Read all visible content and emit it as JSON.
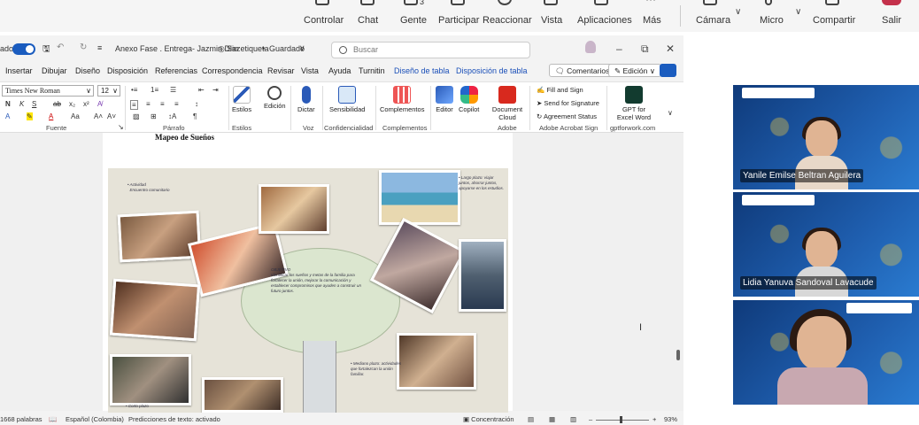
{
  "teams_bar": {
    "items": [
      "Controlar",
      "Chat",
      "Gente",
      "Participar",
      "Reaccionar",
      "Vista",
      "Aplicaciones",
      "Más"
    ],
    "gente_badge": "3",
    "camera_label": "Cámara",
    "mic_label": "Micro",
    "share_label": "Compartir",
    "leave_label": "Salir",
    "leave_color": "#c4314b"
  },
  "word": {
    "autosave_label": "ado",
    "doc_title": "Anexo Fase . Entrega- Jazmin Diaz",
    "sensitivity": "Sin etiqueta",
    "save_state": "Guardado",
    "search_placeholder": "Buscar",
    "menu": [
      "Insertar",
      "Dibujar",
      "Diseño",
      "Disposición",
      "Referencias",
      "Correspondencia",
      "Revisar",
      "Vista",
      "Ayuda",
      "Turnitin",
      "Diseño de tabla",
      "Disposición de tabla"
    ],
    "comments_label": "Comentarios",
    "editing_label": "Edición",
    "ribbon": {
      "font_name": "Times New Roman",
      "font_size": "12",
      "groups": [
        "Fuente",
        "Párrafo",
        "Estilos",
        "Voz",
        "Confidencialidad",
        "Complementos",
        "Adobe",
        "Adobe Acrobat Sign",
        "gptforwork.com"
      ],
      "buttons": {
        "estilos": "Estilos",
        "edicion": "Edición",
        "dictar": "Dictar",
        "sensibilidad": "Sensibilidad",
        "complementos": "Complementos",
        "editor": "Editor",
        "copilot": "Copilot",
        "document_cloud": "Document Cloud",
        "gpt_line1": "GPT for",
        "gpt_line2": "Excel Word"
      },
      "sign_items": [
        "Fill and Sign",
        "Send for Signature",
        "Agreement Status"
      ]
    },
    "doc_heading": "Mapeo de Sueños",
    "status": {
      "words": "1668 palabras",
      "language": "Español (Colombia)",
      "predictions": "Predicciones de texto: activado",
      "focus": "Concentración",
      "zoom": "93%"
    }
  },
  "participants": [
    {
      "name": "Yanile Emilse Beltran Aguilera"
    },
    {
      "name": "Lidia Yanuva Sandoval Lavacude"
    },
    {
      "name": ""
    }
  ]
}
